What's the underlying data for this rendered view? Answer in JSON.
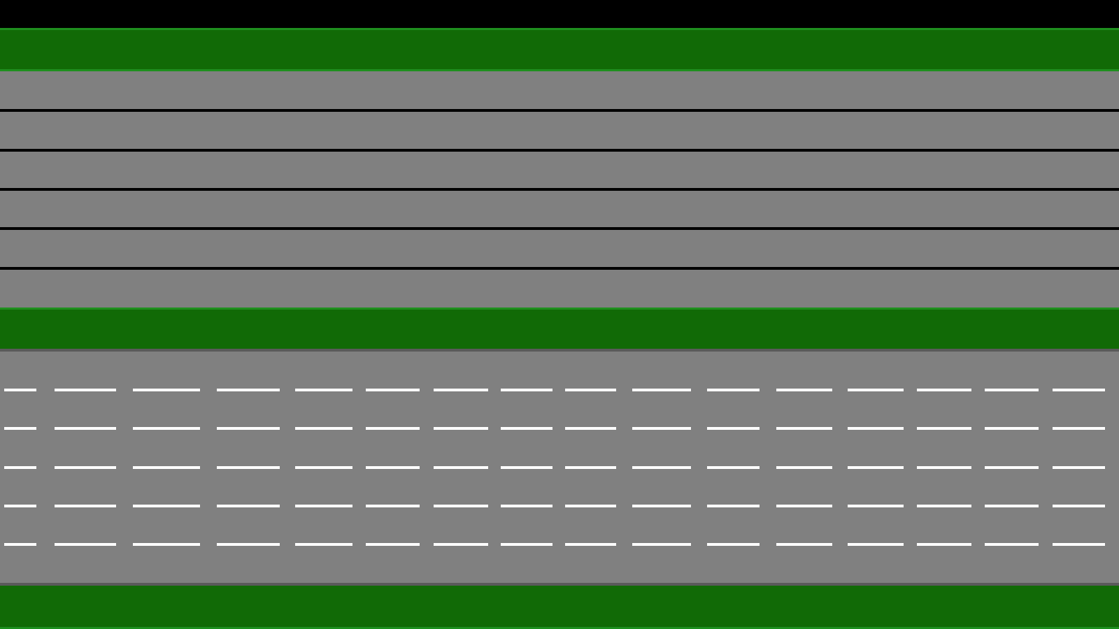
{
  "colors": {
    "void": "#000000",
    "grass": "#116a06",
    "grass_edge": "#1e8f1e",
    "road": "#808080",
    "road_edge": "#5a5a5a",
    "solid_lane_line": "#000000",
    "dashed_lane_line": "#ffffff"
  },
  "scene": {
    "top_road": {
      "lanes": 6,
      "divider_style": "solid",
      "divider_color_name": "black"
    },
    "bottom_road": {
      "lanes": 6,
      "divider_style": "dashed",
      "divider_color_name": "white"
    },
    "grass_strips": 3
  }
}
